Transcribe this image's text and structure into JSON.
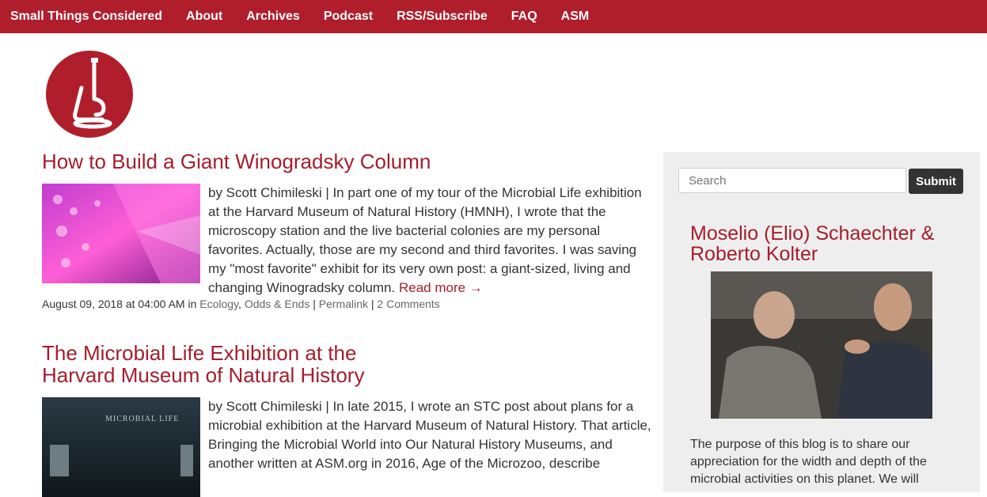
{
  "nav": {
    "items": [
      "Small Things Considered",
      "About",
      "Archives",
      "Podcast",
      "RSS/Subscribe",
      "FAQ",
      "ASM"
    ]
  },
  "logo": {
    "icon": "microscope-icon"
  },
  "posts": [
    {
      "title": "How to Build a Giant Winogradsky Column",
      "body": "by Scott Chimileski | In part one of my tour of the Microbial Life exhibition at the Harvard Museum of Natural History (HMNH), I wrote that the microscopy station and the live bacterial colonies are my personal favorites. Actually, those are my second and third favorites. I was saving my \"most favorite\" exhibit for its very own post: a giant-sized, living and changing Winogradsky column.",
      "read_more": "Read more →",
      "date": "August 09, 2018 at 04:00 AM in",
      "cat1": "Ecology",
      "cat2": "Odds & Ends",
      "permalink": "Permalink",
      "comments": "2 Comments"
    },
    {
      "title_line1": "The Microbial Life Exhibition at the",
      "title_line2": "Harvard Museum of Natural History",
      "body": "by Scott Chimileski | In late 2015, I wrote an STC post about plans for a microbial exhibition at the Harvard Museum of Natural History. That article, Bringing the Microbial World into Our Natural History Museums, and another written at ASM.org in 2016, Age of the Microzoo, describe",
      "thumb_text": "MICROBIAL LIFE"
    }
  ],
  "sidebar": {
    "search_placeholder": "Search",
    "submit_label": "Submit",
    "title": "Moselio (Elio) Schaechter & Roberto Kolter",
    "text": "The purpose of this blog is to share our appreciation for the width and depth of the microbial activities on this planet. We will"
  },
  "colors": {
    "brand": "#b01e2c",
    "link": "#a51d2c",
    "sidebar_bg": "#eeeeee"
  }
}
